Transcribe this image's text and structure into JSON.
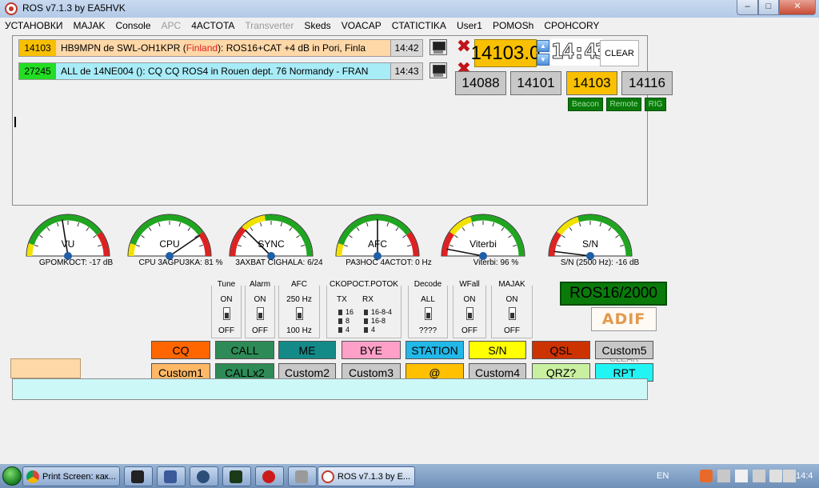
{
  "window": {
    "title": "ROS v7.1.3 by EA5HVK"
  },
  "window_controls": {
    "minimize": "–",
    "maximize": "□",
    "close": "✕"
  },
  "menu": [
    "УСТАНОВКИ",
    "MAJAK",
    "Console",
    "APC",
    "4ACTOTA",
    "Transverter",
    "Skeds",
    "VOACAP",
    "CTATICTIKA",
    "User1",
    "POMOSh",
    "CPOHCORY"
  ],
  "messages": [
    {
      "freq": "14103",
      "text_before": "HB9MPN de SWL-OH1KPR (",
      "text_highlight": "Finland",
      "text_after": "): ROS16+CAT +4 dB in Pori, Finla",
      "time": "14:42",
      "freq_bg": "#f8c000",
      "text_bg": "#ffd8a8"
    },
    {
      "freq": "27245",
      "text_before": "ALL de 14NE004 (): CQ CQ ROS4 in Rouen dept. 76 Normandy - FRAN",
      "text_highlight": "",
      "text_after": "",
      "time": "14:43",
      "freq_bg": "#22dd22",
      "text_bg": "#a8ecf8"
    }
  ],
  "frequency": {
    "display": "14103.0",
    "clock": "14:43",
    "clear_label": "CLEAR",
    "spin_up": "▲",
    "spin_down": "▼"
  },
  "quick_freqs": [
    "14088",
    "14101",
    "14103",
    "14116"
  ],
  "quick_freq_active": 2,
  "mini_labels": [
    "Beacon",
    "Remote",
    "RIG"
  ],
  "gauges": [
    {
      "name": "VU",
      "reading": "GPOMKOCT: -17 dB",
      "level": 0.45
    },
    {
      "name": "CPU",
      "reading": "CPU 3AGPU3KA: 81 %",
      "level": 0.81
    },
    {
      "name": "SYNC",
      "reading": "3AXBAT CIGHALA: 6/24",
      "level": 0.25
    },
    {
      "name": "AFC",
      "reading": "PA3HOC 4ACTOT: 0 Hz",
      "level": 0.5
    },
    {
      "name": "Viterbi",
      "reading": "Viterbi: 96 %",
      "level": 0.06
    },
    {
      "name": "S/N",
      "reading": "S/N (2500 Hz): -16 dB",
      "level": 0.04
    }
  ],
  "toggles": {
    "tune": {
      "title": "Tune",
      "on": "ON",
      "off": "OFF"
    },
    "alarm": {
      "title": "Alarm",
      "on": "ON",
      "off": "OFF"
    },
    "afc": {
      "title": "AFC",
      "on": "250 Hz",
      "off": "100 Hz"
    },
    "speed": {
      "title": "CKOPOCT.POTOK",
      "tx_label": "TX",
      "rx_label": "RX",
      "tx_options": [
        "16",
        "8",
        "4"
      ],
      "rx_options": [
        "16-8-4",
        "16-8",
        "4"
      ]
    },
    "decode": {
      "title": "Decode",
      "on": "ALL",
      "off": "????"
    },
    "wfall": {
      "title": "WFall",
      "on": "ON",
      "off": "OFF"
    },
    "majak": {
      "title": "MAJAK",
      "on": "ON",
      "off": "OFF"
    }
  },
  "mode_display": "ROS16/2000",
  "adif_label": "ADIF",
  "under_text": "CLEAR",
  "macros_row1": [
    {
      "label": "CQ",
      "color": "#ff6600"
    },
    {
      "label": "CALL",
      "color": "#2e8b57"
    },
    {
      "label": "ME",
      "color": "#138a88"
    },
    {
      "label": "BYE",
      "color": "#ffa0c8"
    },
    {
      "label": "STATION",
      "color": "#22b8e8"
    },
    {
      "label": "S/N",
      "color": "#ffff00"
    },
    {
      "label": "QSL",
      "color": "#cc3300"
    },
    {
      "label": "Custom5",
      "color": "#c8c8c8"
    }
  ],
  "macros_row2": [
    {
      "label": "Custom1",
      "color": "#ffb866"
    },
    {
      "label": "CALLx2",
      "color": "#2e8b57"
    },
    {
      "label": "Custom2",
      "color": "#c8c8c8"
    },
    {
      "label": "Custom3",
      "color": "#c8c8c8"
    },
    {
      "label": "@",
      "color": "#ffc000"
    },
    {
      "label": "Custom4",
      "color": "#c8c8c8"
    },
    {
      "label": "QRZ?",
      "color": "#c8f0a0"
    },
    {
      "label": "RPT",
      "color": "#22f4f4"
    }
  ],
  "taskbar": {
    "chrome_task": "Print Screen: как...",
    "ros_task": "ROS v7.1.3 by E...",
    "lang": "EN",
    "clock": "14:4"
  }
}
